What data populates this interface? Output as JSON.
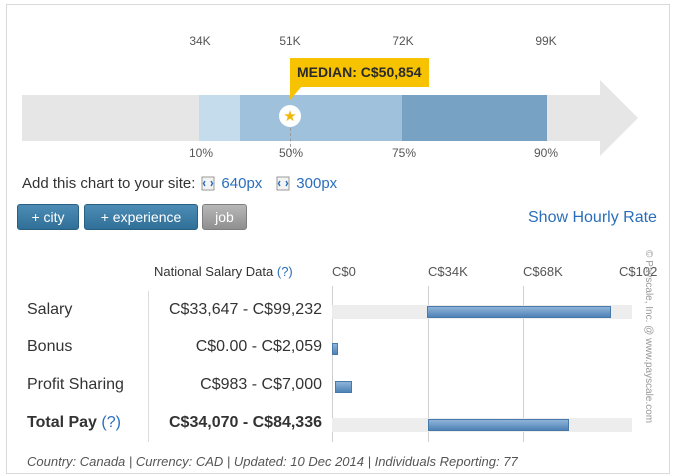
{
  "percentile_chart": {
    "scale_labels": [
      "34K",
      "51K",
      "72K",
      "99K"
    ],
    "percentile_labels": [
      "10%",
      "50%",
      "75%",
      "90%"
    ],
    "median_callout": "MEDIAN: C$50,854",
    "colors": {
      "track": "#e6e6e6",
      "p10_25": "#c4dcec",
      "p25_75": "#9fc1dc",
      "p75_90": "#78a2c4",
      "callout": "#f7c300"
    }
  },
  "embed": {
    "prompt": "Add this chart to your site:",
    "options": [
      "640px",
      "300px"
    ]
  },
  "filters": {
    "city": "+ city",
    "experience": "+ experience",
    "job": "job"
  },
  "hourly_link": "Show Hourly Rate",
  "table": {
    "header_text": "National Salary Data",
    "header_help": "(?)",
    "axis_ticks": [
      "C$0",
      "C$34K",
      "C$68K",
      "C$102"
    ],
    "total_help": "(?)"
  },
  "footer": "Country: Canada | Currency: CAD | Updated: 10 Dec 2014 | Individuals Reporting: 77",
  "watermark": "© Payscale, Inc. @ www.payscale.com",
  "chart_data": {
    "type": "bar",
    "orientation": "horizontal-range",
    "categories": [
      "Salary",
      "Bonus",
      "Profit Sharing",
      "Total Pay"
    ],
    "range_labels": [
      "C$33,647 - C$99,232",
      "C$0.00 - C$2,059",
      "C$983 - C$7,000",
      "C$34,070 - C$84,336"
    ],
    "series": [
      {
        "low": [
          33647,
          0,
          983,
          34070
        ],
        "high": [
          99232,
          2059,
          7000,
          84336
        ]
      }
    ],
    "xlim": [
      0,
      102000
    ],
    "x_ticks": [
      0,
      34000,
      68000,
      102000
    ],
    "percentiles": [
      {
        "label": "10%",
        "value": 34000
      },
      {
        "label": "50%",
        "value": 50854
      },
      {
        "label": "75%",
        "value": 72000
      },
      {
        "label": "90%",
        "value": 99000
      }
    ]
  }
}
